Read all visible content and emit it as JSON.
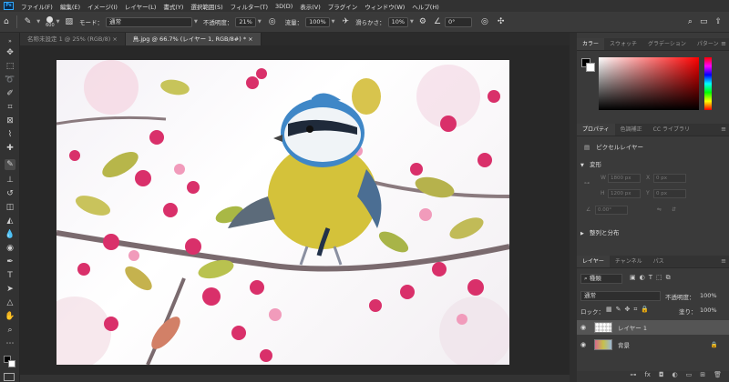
{
  "app": {
    "logo": "Ps"
  },
  "menu": [
    "ファイル(F)",
    "編集(E)",
    "イメージ(I)",
    "レイヤー(L)",
    "書式(Y)",
    "選択範囲(S)",
    "フィルター(T)",
    "3D(D)",
    "表示(V)",
    "プラグイン",
    "ウィンドウ(W)",
    "ヘルプ(H)"
  ],
  "options": {
    "brush_size": "600",
    "mode_label": "モード：",
    "mode_value": "通常",
    "opacity_label": "不透明度：",
    "opacity_value": "21%",
    "flow_label": "流量：",
    "flow_value": "100%",
    "smoothing_label": "滑らかさ：",
    "smoothing_value": "10%",
    "angle_value": "0°"
  },
  "doc_tabs": [
    {
      "label": "名称未設定 1 @ 25% (RGB/8)",
      "active": false
    },
    {
      "label": "鳥.jpg @ 66.7% (レイヤー 1, RGB/8#) *",
      "active": true
    }
  ],
  "color_panel": {
    "tabs": [
      "カラー",
      "スウォッチ",
      "グラデーション",
      "パターン"
    ],
    "active": "カラー"
  },
  "properties_panel": {
    "tabs": [
      "プロパティ",
      "色調補正",
      "CC ライブラリ"
    ],
    "type_label": "ピクセルレイヤー",
    "transform_label": "変形",
    "w_label": "W",
    "w_value": "1800 px",
    "h_label": "H",
    "h_value": "1200 px",
    "x_label": "X",
    "x_value": "0 px",
    "y_label": "Y",
    "y_value": "0 px",
    "angle_value": "0.00°",
    "align_label": "整列と分布"
  },
  "layers_panel": {
    "tabs": [
      "レイヤー",
      "チャンネル",
      "パス"
    ],
    "filter_kind": "種類",
    "blend_mode": "通常",
    "opacity_label": "不透明度：",
    "opacity_value": "100%",
    "lock_label": "ロック：",
    "fill_label": "塗り：",
    "fill_value": "100%",
    "layers": [
      {
        "name": "レイヤー 1",
        "selected": true
      },
      {
        "name": "背景",
        "selected": false
      }
    ]
  },
  "colors": {
    "accent": "#31a8ff",
    "bird_yellow": "#d4c23a",
    "bird_blue": "#3f87c7",
    "blossom_pink": "#d9306a"
  }
}
